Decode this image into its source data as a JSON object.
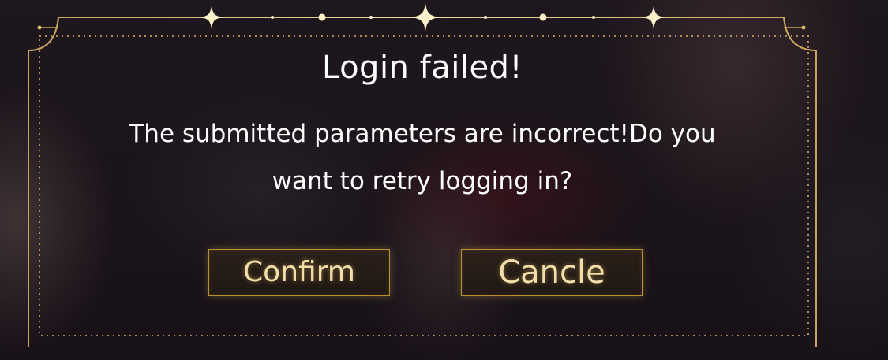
{
  "dialog": {
    "title": "Login failed!",
    "message": "The submitted parameters are incorrect!Do you want to retry logging in?",
    "confirm_label": "Confirm",
    "cancel_label": "Cancle"
  },
  "colors": {
    "accent_gold": "#d9b96a",
    "button_text": "#f3deaa",
    "text": "#ffffff"
  }
}
